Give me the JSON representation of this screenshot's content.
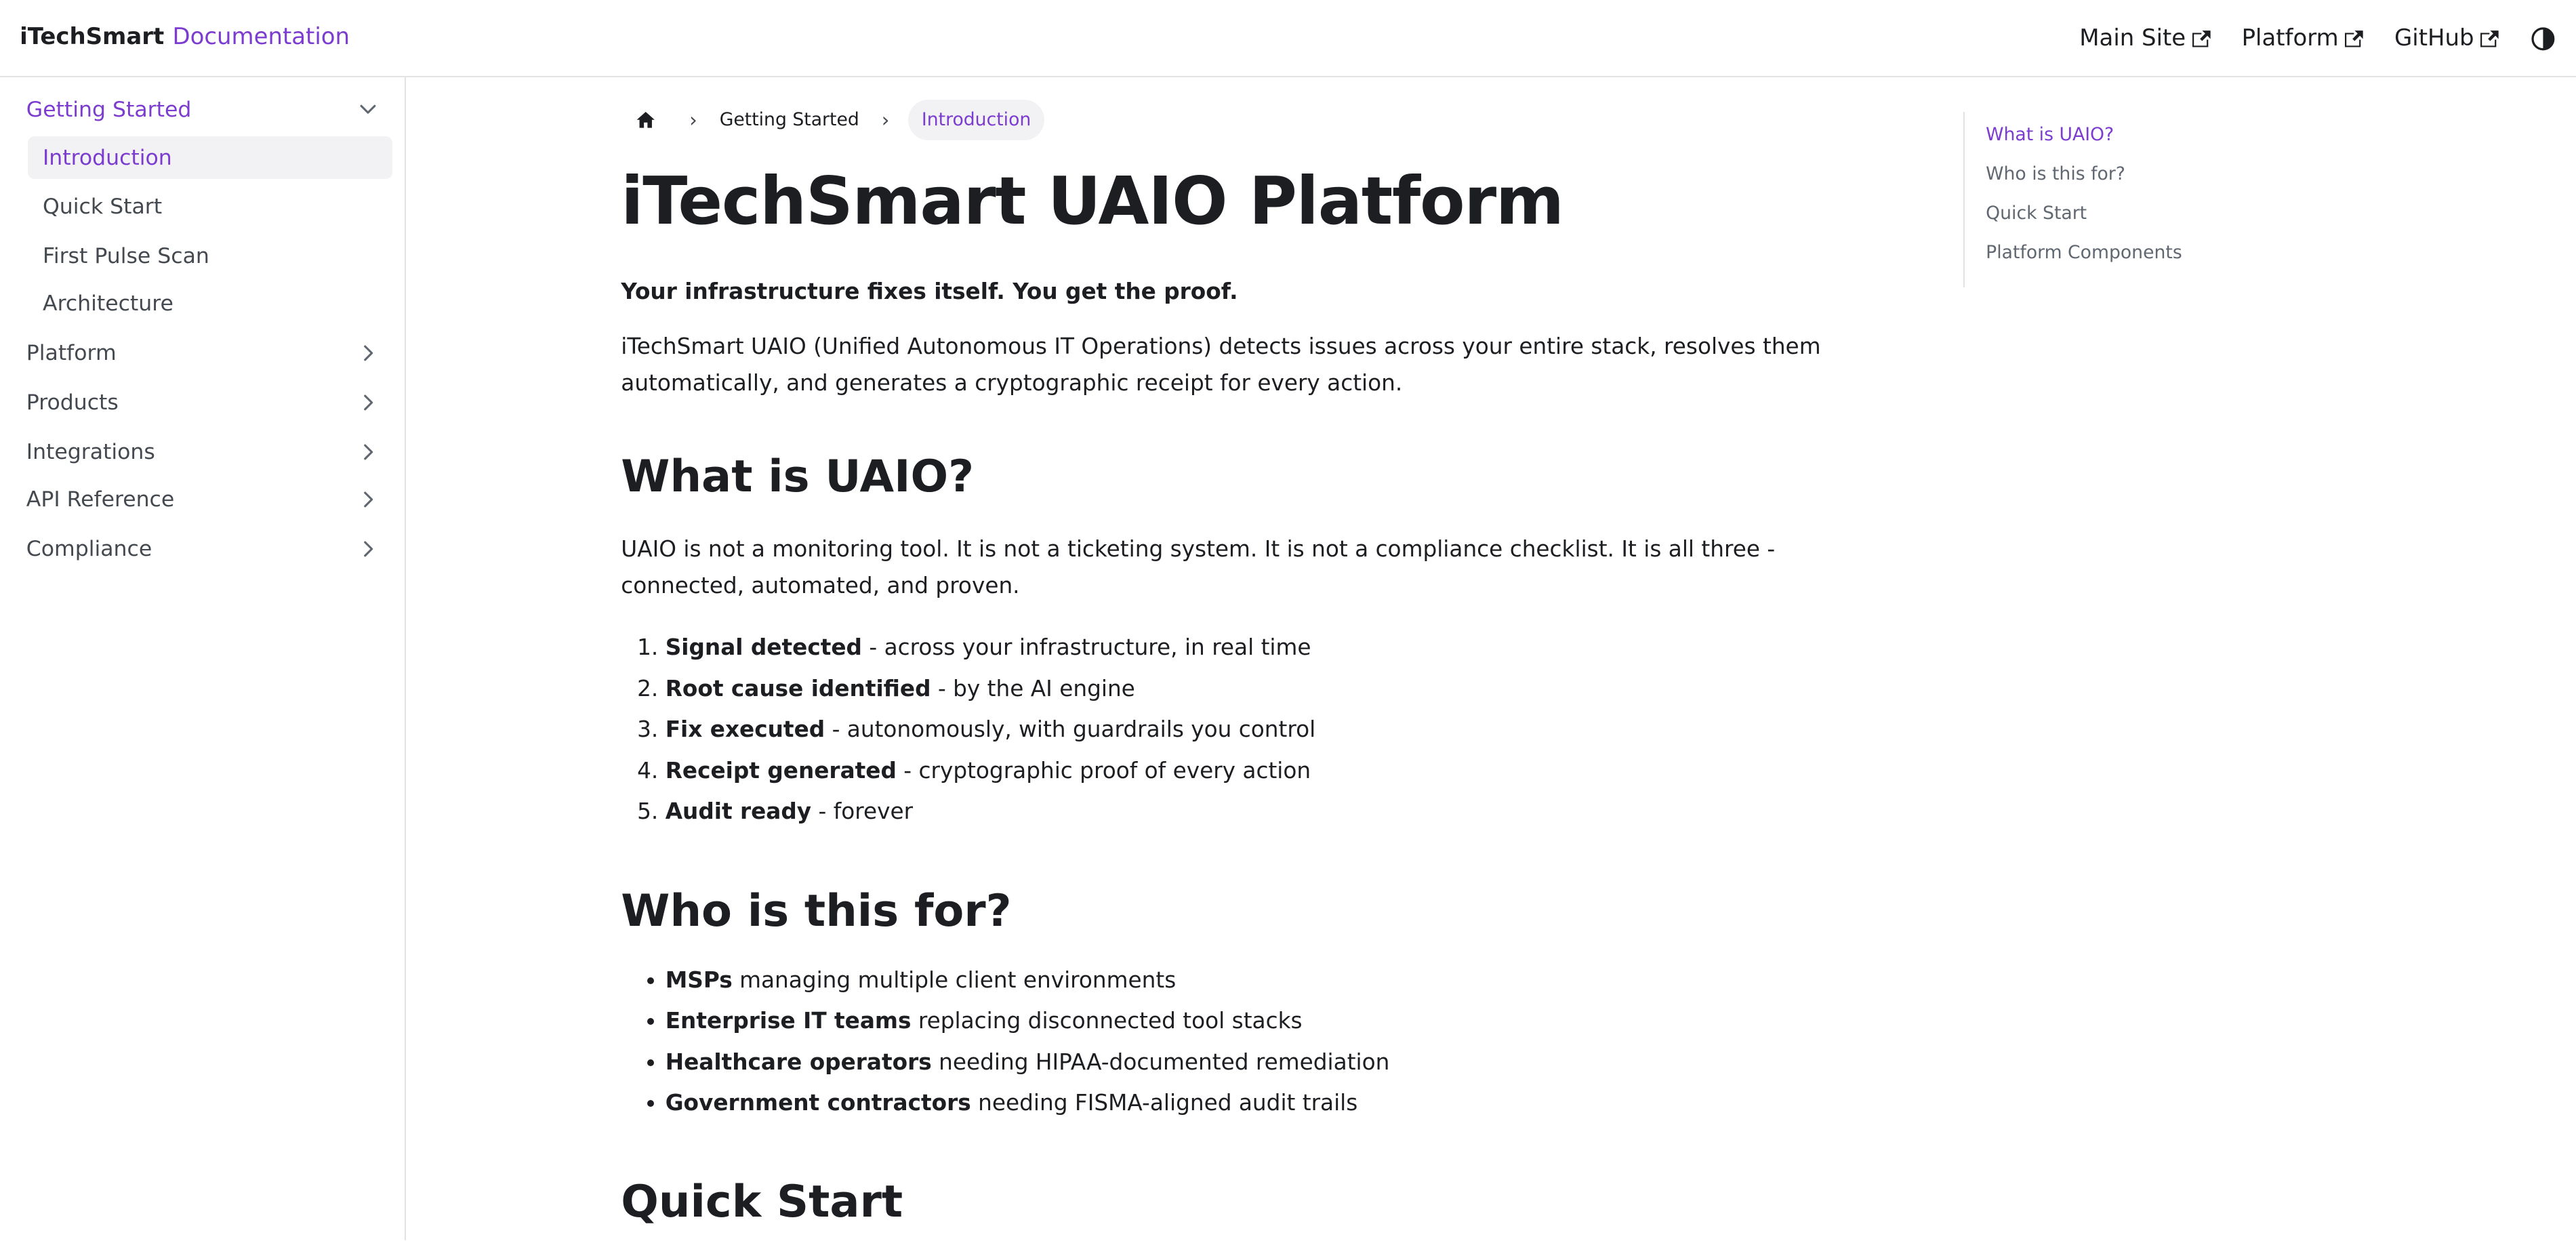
{
  "navbar": {
    "brand": "iTechSmart",
    "doc_label": "Documentation",
    "links": [
      {
        "label": "Main Site",
        "icon": "external-link-icon"
      },
      {
        "label": "Platform",
        "icon": "external-link-icon"
      },
      {
        "label": "GitHub",
        "icon": "external-link-icon"
      }
    ],
    "theme_icon": "contrast-toggle-icon"
  },
  "sidebar": {
    "categories": [
      {
        "label": "Getting Started",
        "expanded": true,
        "active": true,
        "items": [
          {
            "label": "Introduction",
            "active": true
          },
          {
            "label": "Quick Start",
            "active": false
          },
          {
            "label": "First Pulse Scan",
            "active": false
          },
          {
            "label": "Architecture",
            "active": false
          }
        ]
      },
      {
        "label": "Platform",
        "expanded": false
      },
      {
        "label": "Products",
        "expanded": false
      },
      {
        "label": "Integrations",
        "expanded": false
      },
      {
        "label": "API Reference",
        "expanded": false
      },
      {
        "label": "Compliance",
        "expanded": false
      }
    ]
  },
  "breadcrumb": {
    "home_icon": "home-icon",
    "items": [
      "Getting Started",
      "Introduction"
    ]
  },
  "main": {
    "title": "iTechSmart UAIO Platform",
    "lead": "Your infrastructure fixes itself. You get the proof.",
    "intro": "iTechSmart UAIO (Unified Autonomous IT Operations) detects issues across your entire stack, resolves them automatically, and generates a cryptographic receipt for every action.",
    "section1": {
      "heading": "What is UAIO?",
      "para": "UAIO is not a monitoring tool. It is not a ticketing system. It is not a compliance checklist. It is all three - connected, automated, and proven.",
      "steps": [
        {
          "bold": "Signal detected",
          "rest": " - across your infrastructure, in real time"
        },
        {
          "bold": "Root cause identified",
          "rest": " - by the AI engine"
        },
        {
          "bold": "Fix executed",
          "rest": " - autonomously, with guardrails you control"
        },
        {
          "bold": "Receipt generated",
          "rest": " - cryptographic proof of every action"
        },
        {
          "bold": "Audit ready",
          "rest": " - forever"
        }
      ]
    },
    "section2": {
      "heading": "Who is this for?",
      "items": [
        {
          "bold": "MSPs",
          "rest": " managing multiple client environments"
        },
        {
          "bold": "Enterprise IT teams",
          "rest": " replacing disconnected tool stacks"
        },
        {
          "bold": "Healthcare operators",
          "rest": " needing HIPAA-documented remediation"
        },
        {
          "bold": "Government contractors",
          "rest": " needing FISMA-aligned audit trails"
        }
      ]
    },
    "section3": {
      "heading": "Quick Start"
    }
  },
  "toc": {
    "items": [
      {
        "label": "What is UAIO?",
        "active": true
      },
      {
        "label": "Who is this for?",
        "active": false
      },
      {
        "label": "Quick Start",
        "active": false
      },
      {
        "label": "Platform Components",
        "active": false
      }
    ]
  },
  "colors": {
    "accent": "#7c3ccf",
    "text": "#1c1e21",
    "muted": "#444950",
    "border": "#e3e3e3",
    "active_bg": "#f2f2f5"
  }
}
